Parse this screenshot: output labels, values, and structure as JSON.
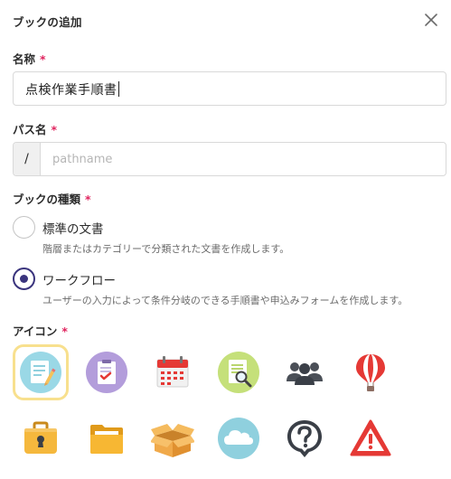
{
  "dialog": {
    "title": "ブックの追加"
  },
  "name_field": {
    "label": "名称",
    "required_mark": "*",
    "value": "点検作業手順書"
  },
  "path_field": {
    "label": "パス名",
    "required_mark": "*",
    "prefix": "/",
    "placeholder": "pathname"
  },
  "book_type": {
    "label": "ブックの種類",
    "required_mark": "*",
    "options": [
      {
        "label": "標準の文書",
        "description": "階層またはカテゴリーで分類された文書を作成します。",
        "selected": false
      },
      {
        "label": "ワークフロー",
        "description": "ユーザーの入力によって条件分岐のできる手順書や申込みフォームを作成します。",
        "selected": true
      }
    ]
  },
  "icon_picker": {
    "label": "アイコン",
    "required_mark": "*",
    "selected_icon": "document-pencil-icon",
    "icons": [
      "document-pencil-icon",
      "checklist-icon",
      "calendar-icon",
      "document-search-icon",
      "people-group-icon",
      "hot-air-balloon-icon",
      "briefcase-lock-icon",
      "folder-icon",
      "open-box-icon",
      "cloud-icon",
      "question-bubble-icon",
      "warning-triangle-icon"
    ]
  },
  "colors": {
    "radio_selected": "#3a347d",
    "required_mark": "#e0245e",
    "selected_icon_border": "#f8e08e"
  }
}
